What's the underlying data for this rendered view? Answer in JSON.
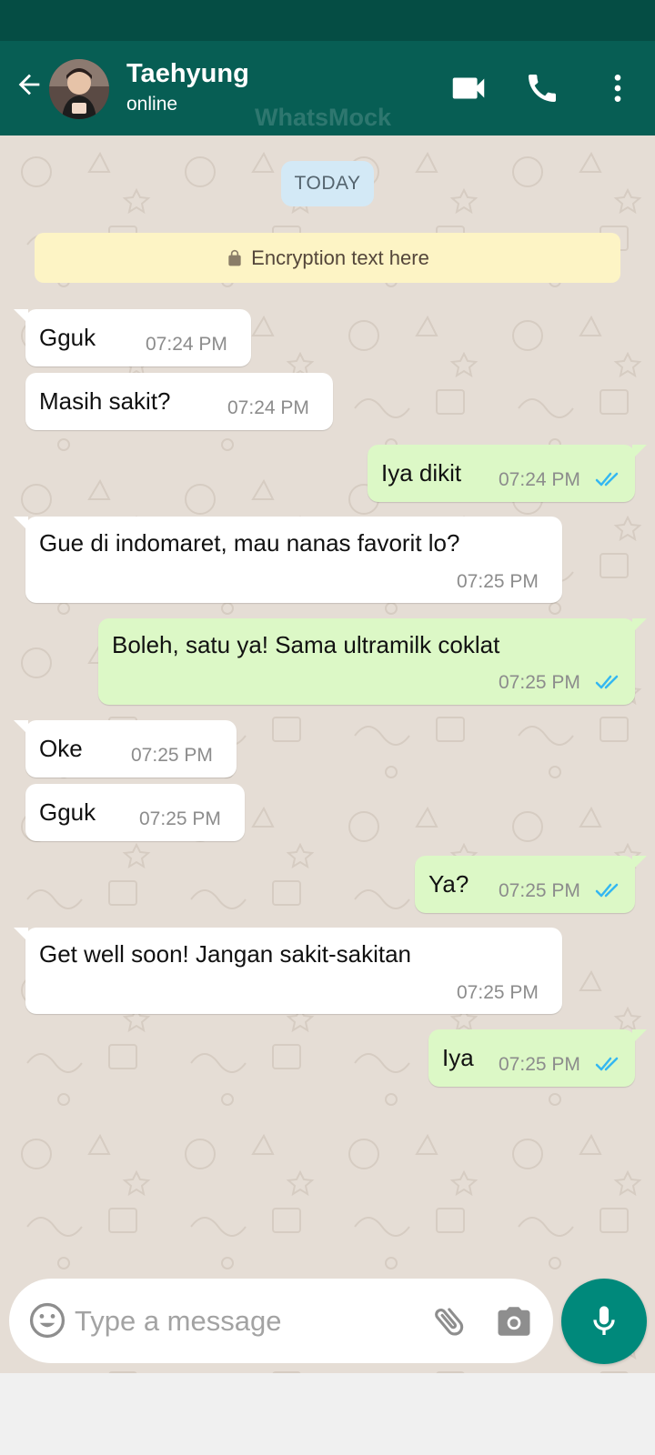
{
  "header": {
    "contact_name": "Taehyung",
    "contact_status": "online",
    "watermark": "WhatsMock",
    "icons": [
      "back-arrow-icon",
      "avatar",
      "video-camera-icon",
      "phone-icon",
      "more-vert-icon"
    ]
  },
  "chat": {
    "date_label": "TODAY",
    "encryption_text": "Encryption text here",
    "messages": [
      {
        "direction": "in",
        "text": "Gguk",
        "time": "07:24 PM"
      },
      {
        "direction": "in",
        "text": "Masih sakit?",
        "time": "07:24 PM"
      },
      {
        "direction": "out",
        "text": "Iya dikit",
        "time": "07:24 PM",
        "status": "read"
      },
      {
        "direction": "in",
        "text": "Gue di indomaret, mau nanas favorit lo?",
        "time": "07:25 PM"
      },
      {
        "direction": "out",
        "text": "Boleh, satu ya! Sama ultramilk coklat",
        "time": "07:25 PM",
        "status": "read"
      },
      {
        "direction": "in",
        "text": "Oke",
        "time": "07:25 PM"
      },
      {
        "direction": "in",
        "text": "Gguk",
        "time": "07:25 PM"
      },
      {
        "direction": "out",
        "text": "Ya?",
        "time": "07:25 PM",
        "status": "read"
      },
      {
        "direction": "in",
        "text": "Get well soon! Jangan sakit-sakitan",
        "time": "07:25 PM"
      },
      {
        "direction": "out",
        "text": "Iya",
        "time": "07:25 PM",
        "status": "read"
      }
    ]
  },
  "composer": {
    "placeholder": "Type a message",
    "value": ""
  },
  "colors": {
    "header": "#075e54",
    "status_bar": "#054d44",
    "chat_bg": "#e5ddd5",
    "incoming_bubble": "#ffffff",
    "outgoing_bubble": "#dcf8c6",
    "read_ticks": "#34b7f1",
    "mic_button": "#00897b"
  }
}
